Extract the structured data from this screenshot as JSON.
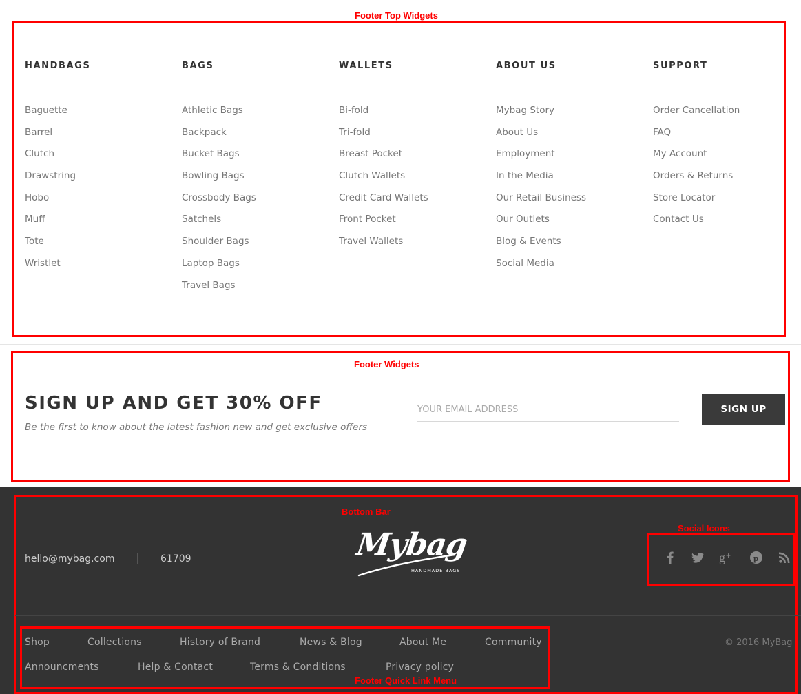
{
  "annotations": {
    "footer_top_widgets": "Footer Top Widgets",
    "footer_widgets": "Footer Widgets",
    "bottom_bar": "Bottom Bar",
    "social_icons": "Social Icons",
    "footer_quick_link_menu": "Footer Quick Link Menu"
  },
  "columns": [
    {
      "title": "HANDBAGS",
      "items": [
        "Baguette",
        "Barrel",
        "Clutch",
        "Drawstring",
        "Hobo",
        "Muff",
        "Tote",
        "Wristlet"
      ]
    },
    {
      "title": "BAGS",
      "items": [
        "Athletic Bags",
        "Backpack",
        "Bucket Bags",
        "Bowling Bags",
        "Crossbody Bags",
        "Satchels",
        "Shoulder Bags",
        "Laptop Bags",
        "Travel Bags"
      ]
    },
    {
      "title": "WALLETS",
      "items": [
        "Bi-fold",
        "Tri-fold",
        "Breast Pocket",
        "Clutch Wallets",
        "Credit Card Wallets",
        "Front Pocket",
        "Travel Wallets"
      ]
    },
    {
      "title": "ABOUT US",
      "items": [
        "Mybag Story",
        "About Us",
        "Employment",
        "In the Media",
        "Our Retail Business",
        "Our Outlets",
        "Blog & Events",
        "Social Media"
      ]
    },
    {
      "title": "SUPPORT",
      "items": [
        "Order Cancellation",
        "FAQ",
        "My Account",
        "Orders & Returns",
        "Store Locator",
        "Contact Us"
      ]
    }
  ],
  "signup": {
    "title": "SIGN UP AND GET 30% OFF",
    "subtitle": "Be the first to know about the latest fashion new and get exclusive offers",
    "email_placeholder": "YOUR EMAIL ADDRESS",
    "button_label": "SIGN UP"
  },
  "bottom_bar": {
    "email": "hello@mybag.com",
    "phone": "61709",
    "logo_text": "Mybag",
    "logo_tagline": "HANDMADE BAGS",
    "social": [
      "facebook-icon",
      "twitter-icon",
      "google-plus-icon",
      "pinterest-icon",
      "rss-icon"
    ],
    "quick_links_row1": [
      "Shop",
      "Collections",
      "History of Brand",
      "News & Blog",
      "About Me",
      "Community"
    ],
    "quick_links_row2": [
      "Announcments",
      "Help & Contact",
      "Terms & Conditions",
      "Privacy policy"
    ],
    "copyright": "© 2016 MyBag"
  },
  "colors": {
    "annotation_red": "#ff0000",
    "heading": "#333333",
    "link": "#777777",
    "bottom_bar_bg": "#333333",
    "button_bg": "#3a3a3a"
  }
}
